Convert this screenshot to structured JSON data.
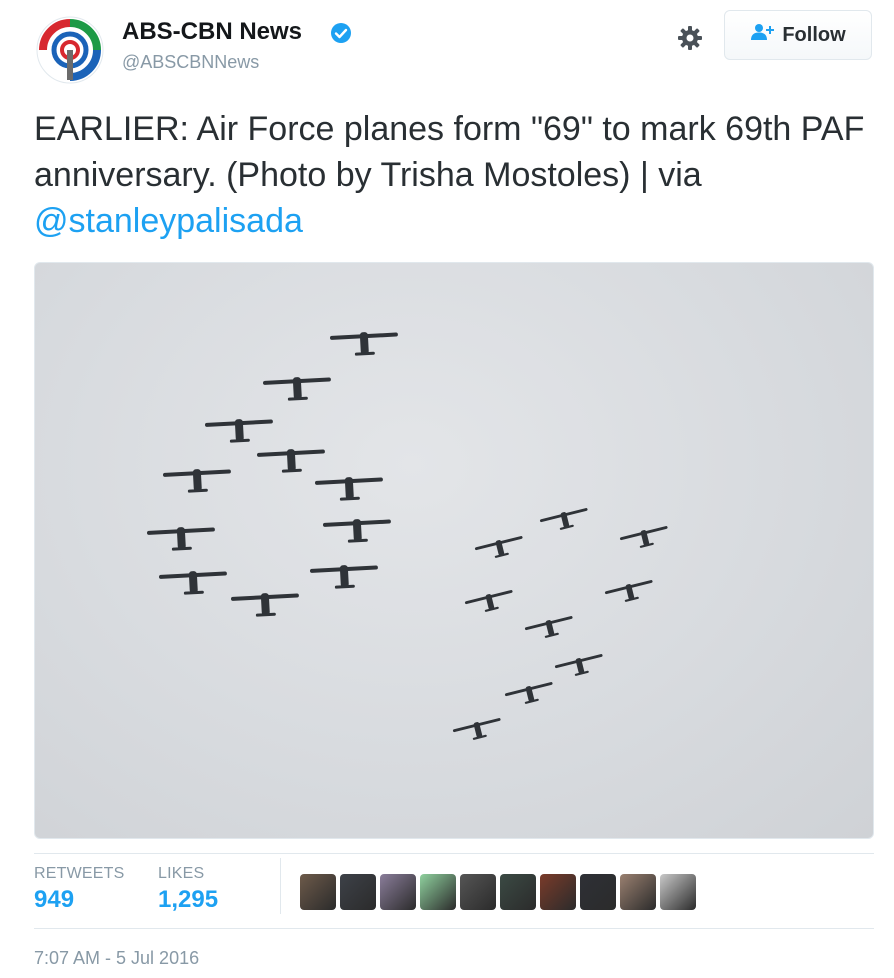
{
  "tweet": {
    "display_name": "ABS-CBN News",
    "handle": "@ABSCBNNews",
    "verified": true,
    "text_before_link": "EARLIER: Air Force planes form \"69\" to mark 69th PAF anniversary. (Photo by Trisha Mostoles) | via ",
    "link_text": "@stanleypalisada",
    "follow_label": "Follow",
    "timestamp": "7:07 AM - 5 Jul 2016"
  },
  "stats": {
    "retweets_label": "RETWEETS",
    "retweets_value": "949",
    "likes_label": "LIKES",
    "likes_value": "1,295"
  },
  "icons": {
    "verified": "verified-badge-icon",
    "settings": "gear-icon",
    "follow": "add-user-icon"
  },
  "colors": {
    "link": "#1da1f2",
    "text": "#292f33",
    "muted": "#8899a6",
    "border": "#e1e8ed"
  },
  "likers": [
    {
      "name": "liker-1",
      "color": "#6d5a4a"
    },
    {
      "name": "liker-2",
      "color": "#3d4148"
    },
    {
      "name": "liker-3",
      "color": "#8a7d9a"
    },
    {
      "name": "liker-4",
      "color": "#8fd19e"
    },
    {
      "name": "liker-5",
      "color": "#555555"
    },
    {
      "name": "liker-6",
      "color": "#3b4a44"
    },
    {
      "name": "liker-7",
      "color": "#7a3b2a"
    },
    {
      "name": "liker-8",
      "color": "#2e3036"
    },
    {
      "name": "liker-9",
      "color": "#9a8070"
    },
    {
      "name": "liker-10",
      "color": "#c9c9c9"
    }
  ]
}
